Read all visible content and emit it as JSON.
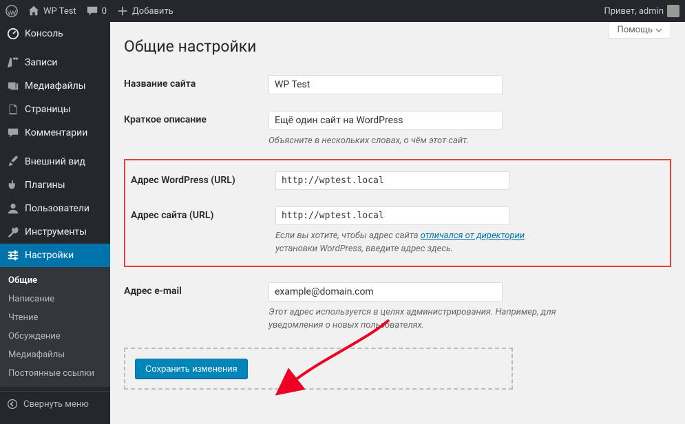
{
  "adminbar": {
    "site_name": "WP Test",
    "comments_count": "0",
    "add_new": "Добавить",
    "greeting": "Привет, admin"
  },
  "sidebar": {
    "items": [
      {
        "label": "Консоль",
        "icon": "dashboard"
      },
      {
        "label": "Записи",
        "icon": "pin"
      },
      {
        "label": "Медиафайлы",
        "icon": "media"
      },
      {
        "label": "Страницы",
        "icon": "page"
      },
      {
        "label": "Комментарии",
        "icon": "comment"
      },
      {
        "label": "Внешний вид",
        "icon": "brush"
      },
      {
        "label": "Плагины",
        "icon": "plugin"
      },
      {
        "label": "Пользователи",
        "icon": "user"
      },
      {
        "label": "Инструменты",
        "icon": "wrench"
      },
      {
        "label": "Настройки",
        "icon": "settings",
        "current": true
      }
    ],
    "submenu": [
      {
        "label": "Общие",
        "current": true
      },
      {
        "label": "Написание"
      },
      {
        "label": "Чтение"
      },
      {
        "label": "Обсуждение"
      },
      {
        "label": "Медиафайлы"
      },
      {
        "label": "Постоянные ссылки"
      }
    ],
    "collapse": "Свернуть меню"
  },
  "main": {
    "help_tab": "Помощь",
    "title": "Общие настройки",
    "fields": {
      "site_title_label": "Название сайта",
      "site_title_value": "WP Test",
      "tagline_label": "Краткое описание",
      "tagline_value": "Ещё один сайт на WordPress",
      "tagline_desc": "Объясните в нескольких словах, о чём этот сайт.",
      "wp_url_label": "Адрес WordPress (URL)",
      "wp_url_value": "http://wptest.local",
      "site_url_label": "Адрес сайта (URL)",
      "site_url_value": "http://wptest.local",
      "site_url_desc_prefix": "Если вы хотите, чтобы адрес сайта ",
      "site_url_desc_link": "отличался от директории",
      "site_url_desc_suffix": " установки WordPress, введите адрес здесь.",
      "email_label": "Адрес e-mail",
      "email_value": "example@domain.com",
      "email_desc": "Этот адрес используется в целях администрирования. Например, для уведомления о новых пользователях."
    },
    "save_button": "Сохранить изменения"
  }
}
